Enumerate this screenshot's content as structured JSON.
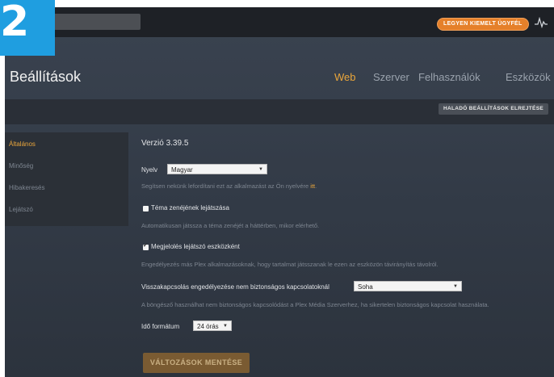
{
  "badge": {
    "step_number": "2"
  },
  "topbar": {
    "premium_label": "LEGYEN KIEMELT ÜGYFÉL",
    "accent_color": "#e5802a"
  },
  "header": {
    "title": "Beállítások",
    "tabs": [
      {
        "label": "Web",
        "active": true
      },
      {
        "label": "Szerver",
        "active": false
      },
      {
        "label": "Felhasználók",
        "active": false
      },
      {
        "label": "Eszközök",
        "active": false
      }
    ],
    "active_color": "#e9a53b"
  },
  "subbar": {
    "advanced_label": "HALADÓ BEÁLLÍTÁSOK ELREJTÉSE"
  },
  "sidebar": {
    "items": [
      {
        "label": "Általános",
        "active": true
      },
      {
        "label": "Minőség",
        "active": false
      },
      {
        "label": "Hibakeresés",
        "active": false
      },
      {
        "label": "Lejátszó",
        "active": false
      }
    ]
  },
  "main": {
    "version": "Verzió 3.39.5",
    "language": {
      "label": "Nyelv",
      "value": "Magyar",
      "help_prefix": "Segítsen nekünk lefordítani ezt az alkalmazást az Ön nyelvére ",
      "help_link": "itt",
      "help_suffix": "."
    },
    "theme_music": {
      "label": "Téma zenéjének lejátszása",
      "checked": true,
      "help": "Automatikusan játssza a téma zenéjét a háttérben, mikor elérhető."
    },
    "remote_player": {
      "label": "Megjelolés lejátszó eszközként",
      "checked": true,
      "help": "Engedélyezés más Plex alkalmazásoknak, hogy tartalmat játsszanak le ezen az eszközön távirányítás távolról."
    },
    "insecure": {
      "label": "Visszakapcsolás engedélyezése nem biztonságos kapcsolatoknál",
      "value": "Soha",
      "help": "A böngésző használhat nem biztonságos kapcsolódást a Plex Média Szerverhez, ha sikertelen biztonságos kapcsolat használata."
    },
    "time_format": {
      "label": "Idő formátum",
      "value": "24 órás"
    },
    "save_label": "VÁLTOZÁSOK MENTÉSE"
  }
}
